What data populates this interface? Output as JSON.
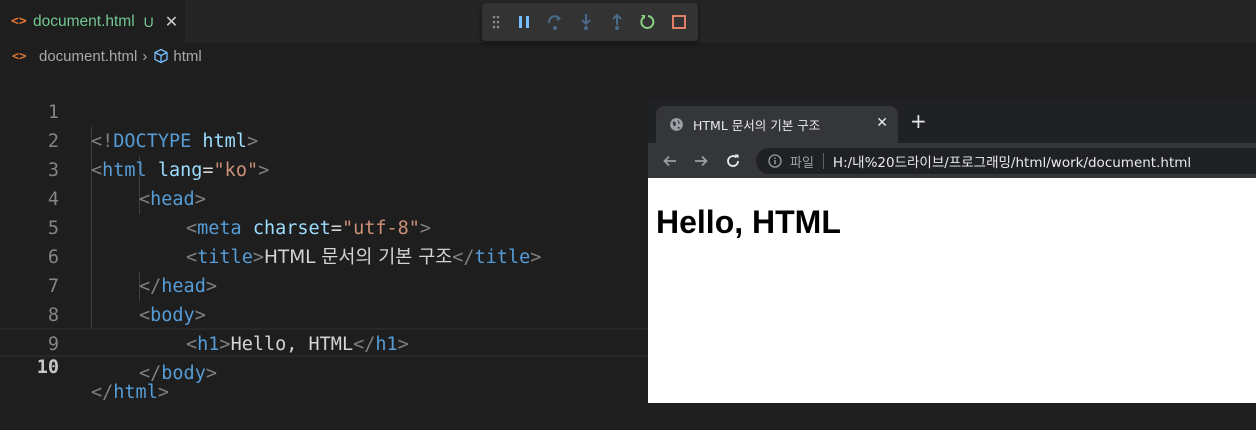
{
  "editor_tab": {
    "icon": "<>",
    "name": "document.html",
    "status": "U",
    "close": "✕"
  },
  "breadcrumb": {
    "file": "document.html",
    "symbol": "html",
    "separator": "›"
  },
  "debug_toolbar": {
    "buttons": [
      "drag-handle",
      "pause",
      "step-over",
      "step-into",
      "step-out",
      "restart",
      "stop"
    ]
  },
  "editor": {
    "active_line": 10,
    "line_numbers": [
      "1",
      "2",
      "3",
      "4",
      "5",
      "6",
      "7",
      "8",
      "9",
      "10"
    ],
    "lines": {
      "l1": [
        "<!",
        "DOCTYPE",
        " html",
        ">"
      ],
      "l2": [
        "<",
        "html",
        " lang",
        "=",
        "\"ko\"",
        ">"
      ],
      "l3": [
        "<",
        "head",
        ">"
      ],
      "l4": [
        "<",
        "meta",
        " charset",
        "=",
        "\"utf-8\"",
        ">"
      ],
      "l5": [
        "<",
        "title",
        ">",
        "HTML 문서의 기본 구조",
        "</",
        "title",
        ">"
      ],
      "l6": [
        "</",
        "head",
        ">"
      ],
      "l7": [
        "<",
        "body",
        ">"
      ],
      "l8": [
        "<",
        "h1",
        ">",
        "Hello, HTML",
        "</",
        "h1",
        ">"
      ],
      "l9": [
        "</",
        "body",
        ">"
      ],
      "l10": [
        "</",
        "html",
        ">"
      ]
    }
  },
  "browser": {
    "tab_title": "HTML 문서의 기본 구조",
    "tab_close": "✕",
    "new_tab": "+",
    "url_scheme": "파일",
    "url": "H:/내%20드라이브/프로그래밍/html/work/document.html",
    "page_heading": "Hello, HTML"
  },
  "colors": {
    "tag": "#569cd6",
    "attribute": "#9cdcfe",
    "string": "#ce9178",
    "punctuation": "#808080",
    "text": "#d4d4d4",
    "untracked": "#73c991"
  }
}
